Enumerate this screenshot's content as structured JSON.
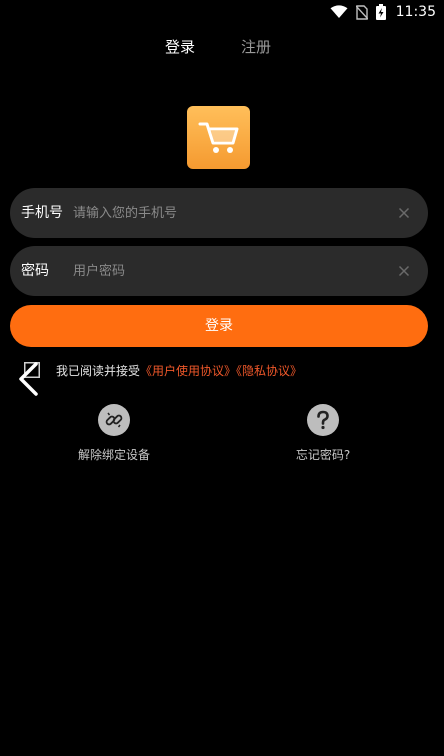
{
  "status_bar": {
    "time": "11:35",
    "icons": [
      "wifi-icon",
      "no-sim-icon",
      "battery-charging-icon"
    ]
  },
  "tabs": [
    {
      "label": "登录",
      "active": true
    },
    {
      "label": "注册",
      "active": false
    }
  ],
  "logo": {
    "icon": "shopping-cart-icon",
    "color_top": "#ffbf5a",
    "color_bottom": "#f59a30"
  },
  "form": {
    "phone": {
      "label": "手机号",
      "placeholder": "请输入您的手机号",
      "value": ""
    },
    "password": {
      "label": "密码",
      "placeholder": "用户密码",
      "value": ""
    },
    "login_button": "登录",
    "accent_color": "#ff6d10"
  },
  "agreement": {
    "prefix": "我已阅读并接受",
    "user_agreement": "《用户使用协议》",
    "privacy_policy": "《隐私协议》",
    "link_color": "#f0582a"
  },
  "actions": {
    "unbind_device": "解除绑定设备",
    "forgot_password": "忘记密码?"
  }
}
